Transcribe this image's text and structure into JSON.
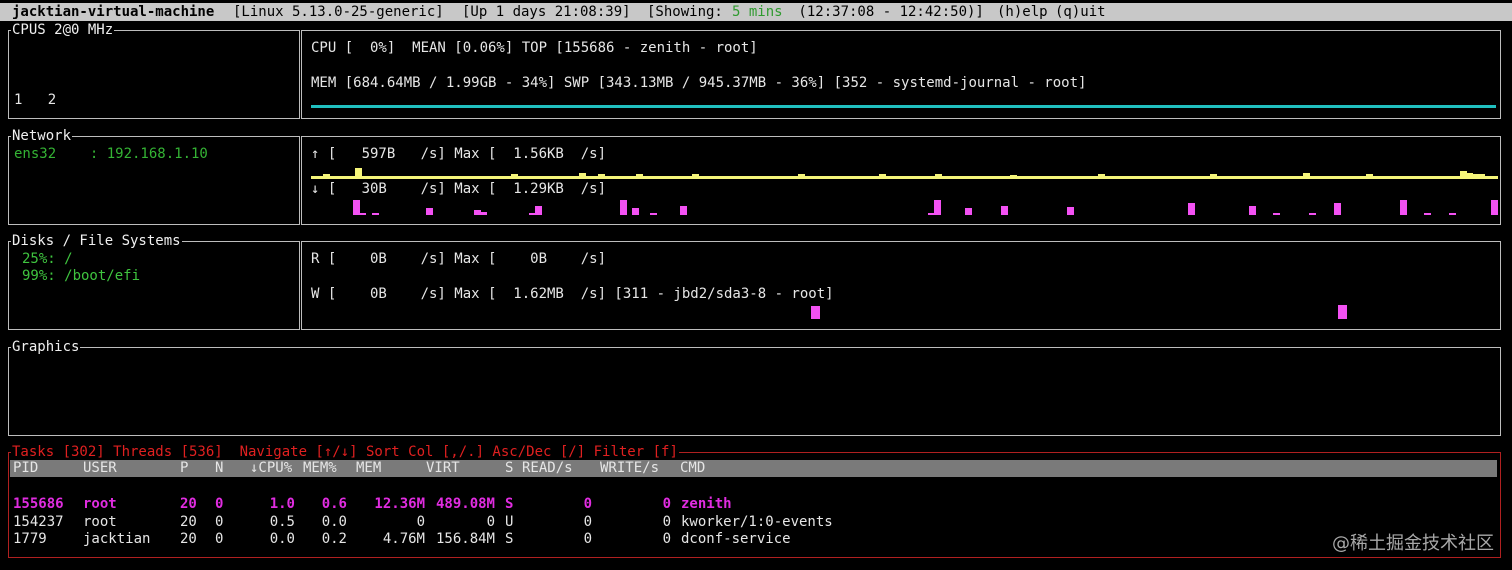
{
  "topbar": {
    "host": "jacktian-virtual-machine",
    "kernel": "[Linux 5.13.0-25-generic]",
    "uptime": "[Up 1 days 21:08:39]",
    "showing_prefix": "[Showing: ",
    "showing_value": "5 mins",
    "showing_range": " (12:37:08 - 12:42:50)]",
    "help": "(h)elp",
    "quit": "(q)uit"
  },
  "cpus": {
    "title": "CPUS 2@0 MHz",
    "core_labels": "1   2",
    "cpu_line": "CPU [  0%]  MEAN [0.06%] TOP [155686 - zenith - root]",
    "mem_line": "MEM [684.64MB / 1.99GB - 34%] SWP [343.13MB / 945.37MB - 36%] [352 - systemd-journal - root]"
  },
  "network": {
    "title": "Network",
    "iface": "ens32    : 192.168.1.10",
    "up_line": "↑ [   597B   /s] Max [  1.56KB  /s]",
    "down_line": "↓ [   30B    /s] Max [  1.29KB  /s]",
    "up_series_frac": [
      0.15,
      0.15,
      0.3,
      0.2,
      0.15,
      0.2,
      0.15,
      0.7,
      0.15,
      0.2,
      0.15,
      0.15,
      0.2,
      0.15,
      0.15,
      0.2,
      0.15,
      0.15,
      0.15,
      0.2,
      0.15,
      0.15,
      0.15,
      0.2,
      0.15,
      0.2,
      0.15,
      0.15,
      0.15,
      0.2,
      0.15,
      0.15,
      0.3,
      0.2,
      0.15,
      0.15,
      0.2,
      0.15,
      0.15,
      0.2,
      0.15,
      0.15,
      0.15,
      0.4,
      0.2,
      0.15,
      0.3,
      0.15,
      0.15,
      0.2,
      0.15,
      0.15,
      0.3,
      0.2,
      0.15,
      0.2,
      0.15,
      0.15,
      0.2,
      0.15,
      0.15,
      0.35,
      0.2,
      0.15,
      0.15,
      0.2,
      0.15,
      0.15,
      0.2,
      0.15,
      0.2,
      0.15,
      0.15,
      0.2,
      0.15,
      0.15,
      0.2,
      0.15,
      0.3,
      0.15,
      0.15,
      0.2,
      0.15,
      0.15,
      0.2,
      0.15,
      0.15,
      0.15,
      0.2,
      0.15,
      0.2,
      0.3,
      0.15,
      0.15,
      0.2,
      0.15,
      0.15,
      0.2,
      0.15,
      0.15,
      0.3,
      0.2,
      0.15,
      0.15,
      0.2,
      0.15,
      0.15,
      0.2,
      0.15,
      0.15,
      0.2,
      0.15,
      0.25,
      0.15,
      0.15,
      0.2,
      0.15,
      0.15,
      0.2,
      0.15,
      0.15,
      0.15,
      0.2,
      0.15,
      0.15,
      0.2,
      0.3,
      0.15,
      0.15,
      0.2,
      0.15,
      0.15,
      0.2,
      0.15,
      0.15,
      0.15,
      0.15,
      0.2,
      0.15,
      0.15,
      0.2,
      0.15,
      0.15,
      0.2,
      0.3,
      0.15,
      0.15,
      0.2,
      0.15,
      0.15,
      0.2,
      0.15,
      0.15,
      0.15,
      0.2,
      0.15,
      0.15,
      0.2,
      0.15,
      0.4,
      0.15,
      0.15,
      0.2,
      0.15,
      0.15,
      0.15,
      0.2,
      0.15,
      0.15,
      0.3,
      0.15,
      0.15,
      0.2,
      0.15,
      0.15,
      0.15,
      0.15,
      0.2,
      0.15,
      0.15,
      0.15,
      0.2,
      0.15,
      0.15,
      0.5,
      0.4,
      0.3,
      0.3,
      0.15,
      0.15
    ],
    "down_series_frac": [
      0,
      0,
      0,
      0,
      0,
      0,
      0,
      1,
      0.15,
      0,
      0.15,
      0,
      0,
      0,
      0,
      0,
      0,
      0,
      0,
      0.45,
      0,
      0,
      0,
      0,
      0,
      0,
      0,
      0.35,
      0.2,
      0,
      0,
      0,
      0,
      0,
      0,
      0,
      0.15,
      0.6,
      0,
      0,
      0,
      0,
      0,
      0,
      0,
      0,
      0,
      0,
      0,
      0,
      0,
      1,
      0,
      0.45,
      0,
      0,
      0.15,
      0,
      0,
      0,
      0,
      0.6,
      0,
      0,
      0,
      0,
      0,
      0,
      0,
      0,
      0,
      0,
      0,
      0,
      0,
      0,
      0,
      0,
      0,
      0,
      0,
      0,
      0,
      0,
      0,
      0,
      0,
      0,
      0,
      0,
      0,
      0,
      0,
      0,
      0,
      0,
      0,
      0,
      0,
      0,
      0,
      0,
      0.15,
      1,
      0,
      0,
      0,
      0,
      0.45,
      0,
      0,
      0,
      0,
      0,
      0.6,
      0,
      0,
      0,
      0,
      0,
      0,
      0,
      0,
      0,
      0,
      0.55,
      0,
      0,
      0,
      0,
      0,
      0,
      0,
      0,
      0,
      0,
      0,
      0,
      0,
      0,
      0,
      0,
      0,
      0,
      0,
      0.8,
      0,
      0,
      0,
      0,
      0,
      0,
      0,
      0,
      0,
      0.6,
      0,
      0,
      0,
      0.15,
      0,
      0,
      0,
      0,
      0,
      0.15,
      0,
      0,
      0,
      0.8,
      0,
      0,
      0,
      0,
      0,
      0,
      0,
      0,
      0,
      0,
      1,
      0,
      0,
      0,
      0.15,
      0,
      0,
      0,
      0.15,
      0,
      0,
      0,
      0,
      0,
      0,
      1
    ]
  },
  "disks": {
    "title": "Disks / File Systems",
    "fs": [
      "25%: /",
      "99%: /boot/efi"
    ],
    "read_line": "R [    0B    /s] Max [    0B    /s]",
    "write_line": "W [    0B    /s] Max [  1.62MB  /s] [311 - jbd2/sda3-8 - root]"
  },
  "graphics": {
    "title": "Graphics"
  },
  "tasks": {
    "title_prefix": "Tasks [302] Threads [536]  Navigate [↑/↓] Sort Col [,/.] Asc/Dec [/] Filter [f]",
    "headers": [
      "PID",
      "USER",
      "P",
      "N",
      "↓CPU%",
      "MEM%",
      "MEM",
      "VIRT",
      "S",
      "READ/s",
      "WRITE/s",
      "CMD"
    ],
    "rows": [
      [
        "155686",
        "root",
        "20",
        "0",
        "1.0",
        "0.6",
        "12.36M",
        "489.08M",
        "S",
        "0",
        "0",
        "zenith"
      ],
      [
        "154237",
        "root",
        "20",
        "0",
        "0.5",
        "0.0",
        "0",
        "0",
        "U",
        "0",
        "0",
        "kworker/1:0-events"
      ],
      [
        "1779",
        "jacktian",
        "20",
        "0",
        "0.0",
        "0.2",
        "4.76M",
        "156.84M",
        "S",
        "0",
        "0",
        "dconf-service"
      ]
    ]
  },
  "watermark": "@稀土掘金技术社区",
  "colors": {
    "network_up": "#f5f57a",
    "network_down": "#f351f3",
    "memory_bar": "#20c0c0",
    "tasks_accent": "#e02020",
    "selected_row": "#e02ce0"
  }
}
